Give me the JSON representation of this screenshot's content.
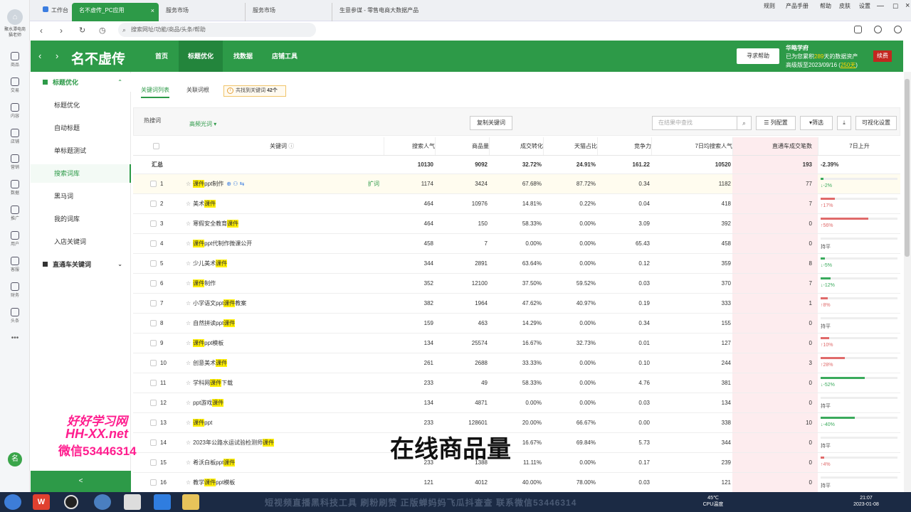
{
  "left_rail": {
    "app_title": "聚水潭电商",
    "user": "猫老师",
    "items": [
      "商品",
      "交易",
      "内容",
      "店铺",
      "营销",
      "数据",
      "推广",
      "用户",
      "客服",
      "财务",
      "头条"
    ],
    "badge": "名"
  },
  "browser": {
    "tabs": [
      {
        "label": "工作台"
      },
      {
        "label": "名不虚传_PC应用",
        "active": true
      },
      {
        "label": "服务市场"
      },
      {
        "label": "服务市场"
      },
      {
        "label": "生意参谋 - 零售电商大数据产品"
      }
    ],
    "top_menu": [
      "规则",
      "产品手册",
      "帮助",
      "皮肤",
      "设置"
    ],
    "address_placeholder": "搜索网址/功能/商品/头条/帮助"
  },
  "header": {
    "logo": "名不虚传",
    "nav": [
      "首页",
      "标题优化",
      "找数据",
      "店铺工具"
    ],
    "active_nav": "标题优化",
    "help_button": "寻求帮助",
    "info_title": "华略学府",
    "info_line1_pre": "已为您累积",
    "info_days": "289",
    "info_line1_post": "天的数据资产",
    "info_line2_pre": "高级版至2023/09/16 (",
    "info_remaining": "250天",
    "info_line2_post": ")",
    "renew": "续费"
  },
  "sidebar": {
    "group1": "标题优化",
    "items": [
      "标题优化",
      "自动标题",
      "单标题测试",
      "搜索词库",
      "黑马词",
      "我的词库",
      "入店关键词"
    ],
    "active": "搜索词库",
    "group2": "直通车关键词",
    "collapse": "<"
  },
  "subtabs": {
    "tab1": "关键词列表",
    "tab2": "关联词根",
    "notice_pre": "共找到关键词 ",
    "notice_count": "42个"
  },
  "filter": {
    "label": "热搜词",
    "select": "高频光词",
    "copy_button": "复制关键词",
    "search_placeholder": "在结果中查找",
    "columns_button": "列配置",
    "filter_button": "筛选",
    "export_icon": "⤓",
    "visual_button": "可视化设置"
  },
  "table": {
    "headers": {
      "keyword": "关键词",
      "search": "搜索人气",
      "goods": "商品量",
      "conv": "成交转化",
      "tmall": "天猫占比",
      "comp": "竞争力",
      "avg7": "7日均搜索人气",
      "ztc": "直通车成交笔数",
      "rise7": "7日上升"
    },
    "summary": {
      "label": "汇总",
      "search": "10130",
      "goods": "9092",
      "conv": "32.72%",
      "tmall": "24.91%",
      "comp": "161.22",
      "avg7": "10520",
      "ztc": "193",
      "rise": "-2.39%"
    },
    "expand_label": "扩词",
    "rows": [
      {
        "n": "1",
        "pre": "",
        "mark": "课件",
        "post": "ppt制作",
        "search": "1174",
        "goods": "3424",
        "conv": "67.68%",
        "tmall": "87.72%",
        "comp": "0.34",
        "avg7": "1182",
        "ztc": "77",
        "trend": "-2%",
        "dir": "down",
        "level": 0.02
      },
      {
        "n": "2",
        "pre": "美术",
        "mark": "课件",
        "post": "",
        "search": "464",
        "goods": "10976",
        "conv": "14.81%",
        "tmall": "0.22%",
        "comp": "0.04",
        "avg7": "418",
        "ztc": "7",
        "trend": "17%",
        "dir": "up",
        "level": 0.17
      },
      {
        "n": "3",
        "pre": "寒假安全教育",
        "mark": "课件",
        "post": "",
        "search": "464",
        "goods": "150",
        "conv": "58.33%",
        "tmall": "0.00%",
        "comp": "3.09",
        "avg7": "392",
        "ztc": "0",
        "trend": "56%",
        "dir": "up",
        "level": 0.56
      },
      {
        "n": "4",
        "pre": "",
        "mark": "课件",
        "post": "ppt代制作微课公开",
        "search": "458",
        "goods": "7",
        "conv": "0.00%",
        "tmall": "0.00%",
        "comp": "65.43",
        "avg7": "458",
        "ztc": "0",
        "trend": "持平",
        "dir": "flat",
        "level": 0
      },
      {
        "n": "5",
        "pre": "少儿美术",
        "mark": "课件",
        "post": "",
        "search": "344",
        "goods": "2891",
        "conv": "63.64%",
        "tmall": "0.00%",
        "comp": "0.12",
        "avg7": "359",
        "ztc": "8",
        "trend": "-5%",
        "dir": "down",
        "level": 0.05
      },
      {
        "n": "6",
        "pre": "",
        "mark": "课件",
        "post": "制作",
        "search": "352",
        "goods": "12100",
        "conv": "37.50%",
        "tmall": "59.52%",
        "comp": "0.03",
        "avg7": "370",
        "ztc": "7",
        "trend": "-12%",
        "dir": "down",
        "level": 0.12
      },
      {
        "n": "7",
        "pre": "小学语文ppt",
        "mark": "课件",
        "post": "教案",
        "search": "382",
        "goods": "1964",
        "conv": "47.62%",
        "tmall": "40.97%",
        "comp": "0.19",
        "avg7": "333",
        "ztc": "1",
        "trend": "8%",
        "dir": "up",
        "level": 0.08
      },
      {
        "n": "8",
        "pre": "自然拼读ppt",
        "mark": "课件",
        "post": "",
        "search": "159",
        "goods": "463",
        "conv": "14.29%",
        "tmall": "0.00%",
        "comp": "0.34",
        "avg7": "155",
        "ztc": "0",
        "trend": "持平",
        "dir": "flat",
        "level": 0
      },
      {
        "n": "9",
        "pre": "",
        "mark": "课件",
        "post": "ppt模板",
        "search": "134",
        "goods": "25574",
        "conv": "16.67%",
        "tmall": "32.73%",
        "comp": "0.01",
        "avg7": "127",
        "ztc": "0",
        "trend": "10%",
        "dir": "up",
        "level": 0.1
      },
      {
        "n": "10",
        "pre": "创意美术",
        "mark": "课件",
        "post": "",
        "search": "261",
        "goods": "2688",
        "conv": "33.33%",
        "tmall": "0.00%",
        "comp": "0.10",
        "avg7": "244",
        "ztc": "3",
        "trend": "28%",
        "dir": "up",
        "level": 0.28
      },
      {
        "n": "11",
        "pre": "学科网",
        "mark": "课件",
        "post": "下载",
        "search": "233",
        "goods": "49",
        "conv": "58.33%",
        "tmall": "0.00%",
        "comp": "4.76",
        "avg7": "381",
        "ztc": "0",
        "trend": "-52%",
        "dir": "down",
        "level": 0.52
      },
      {
        "n": "12",
        "pre": "ppt游戏",
        "mark": "课件",
        "post": "",
        "search": "134",
        "goods": "4871",
        "conv": "0.00%",
        "tmall": "0.00%",
        "comp": "0.03",
        "avg7": "134",
        "ztc": "0",
        "trend": "持平",
        "dir": "flat",
        "level": 0
      },
      {
        "n": "13",
        "pre": "",
        "mark": "课件",
        "post": "ppt",
        "search": "233",
        "goods": "128601",
        "conv": "20.00%",
        "tmall": "66.67%",
        "comp": "0.00",
        "avg7": "338",
        "ztc": "10",
        "trend": "-40%",
        "dir": "down",
        "level": 0.4
      },
      {
        "n": "14",
        "pre": "2023年公路水运试验检测师",
        "mark": "课件",
        "post": "",
        "search": "",
        "goods": "",
        "conv": "16.67%",
        "tmall": "69.84%",
        "comp": "5.73",
        "avg7": "344",
        "ztc": "0",
        "trend": "持平",
        "dir": "flat",
        "level": 0
      },
      {
        "n": "15",
        "pre": "希沃白板ppt",
        "mark": "课件",
        "post": "",
        "search": "233",
        "goods": "1388",
        "conv": "11.11%",
        "tmall": "0.00%",
        "comp": "0.17",
        "avg7": "239",
        "ztc": "0",
        "trend": "4%",
        "dir": "up",
        "level": 0.04
      },
      {
        "n": "16",
        "pre": "教学",
        "mark": "课件",
        "post": "ppt模板",
        "search": "121",
        "goods": "4012",
        "conv": "40.00%",
        "tmall": "78.00%",
        "comp": "0.03",
        "avg7": "121",
        "ztc": "0",
        "trend": "持平",
        "dir": "flat",
        "level": 0
      }
    ]
  },
  "overlay": {
    "wm1": "好好学习网",
    "wm2": "HH-XX.net",
    "wm3": "微信53446314",
    "caption": "在线商品量",
    "scroll": "短视频直播黑科技工具 刷粉刷赞 正版蝉妈妈飞瓜抖查查 联系微信53446314"
  },
  "taskbar": {
    "temp": "45℃",
    "temp_label": "CPU温度",
    "time": "21:07",
    "date": "2023-01-08"
  },
  "colors": {
    "brand": "#2d9a48",
    "up": "#e06a6a",
    "down": "#3aaa5c",
    "renew": "#c2271f"
  }
}
